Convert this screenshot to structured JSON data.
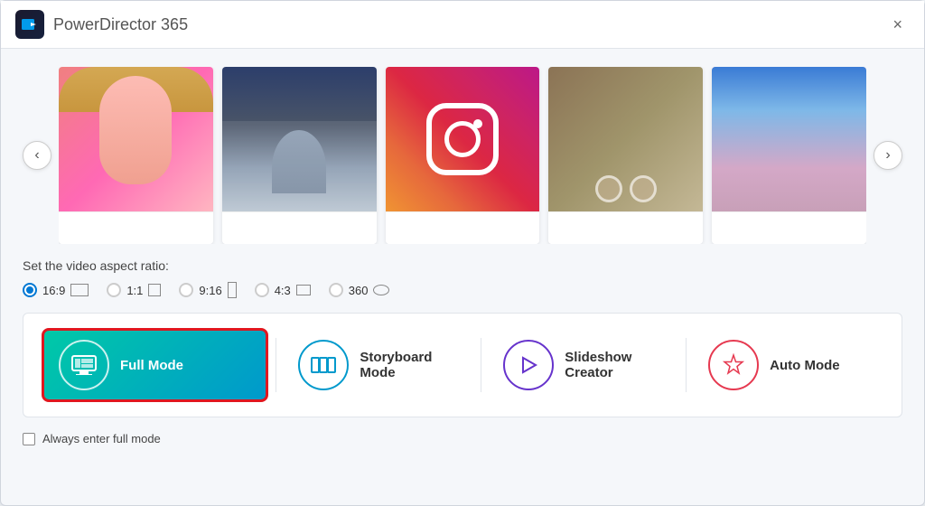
{
  "app": {
    "title": "PowerDirector",
    "version": "365",
    "close_label": "×"
  },
  "carousel": {
    "prev_label": "‹",
    "next_label": "›",
    "thumbnails": [
      {
        "id": "pink-girl",
        "type": "pink-girl"
      },
      {
        "id": "castle",
        "type": "castle"
      },
      {
        "id": "instagram",
        "type": "instagram"
      },
      {
        "id": "food",
        "type": "food"
      },
      {
        "id": "woman",
        "type": "woman"
      }
    ]
  },
  "aspect": {
    "label": "Set the video aspect ratio:",
    "options": [
      {
        "value": "16:9",
        "label": "16:9",
        "shape": "wide",
        "selected": true
      },
      {
        "value": "1:1",
        "label": "1:1",
        "shape": "square",
        "selected": false
      },
      {
        "value": "9:16",
        "label": "9:16",
        "shape": "tall",
        "selected": false
      },
      {
        "value": "4:3",
        "label": "4:3",
        "shape": "43",
        "selected": false
      },
      {
        "value": "360",
        "label": "360",
        "shape": "360",
        "selected": false
      }
    ]
  },
  "modes": [
    {
      "id": "full",
      "label": "Full Mode",
      "style": "full"
    },
    {
      "id": "storyboard",
      "label": "Storyboard Mode",
      "style": "storyboard"
    },
    {
      "id": "slideshow",
      "label": "Slideshow Creator",
      "style": "slideshow"
    },
    {
      "id": "auto",
      "label": "Auto Mode",
      "style": "auto"
    }
  ],
  "checkbox": {
    "label": "Always enter full mode",
    "checked": false
  }
}
